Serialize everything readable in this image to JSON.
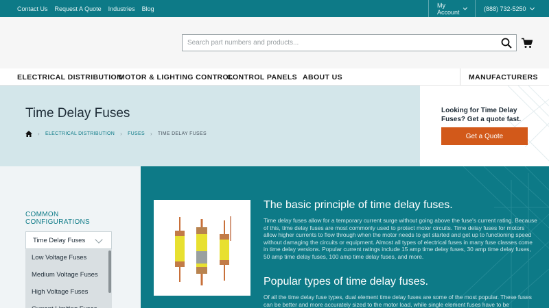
{
  "topbar": {
    "links": [
      "Contact Us",
      "Request A Quote",
      "Industries",
      "Blog"
    ],
    "account": "My Account",
    "phone": "(888) 732-5250"
  },
  "search": {
    "placeholder": "Search part numbers and products..."
  },
  "nav": {
    "items": [
      "ELECTRICAL DISTRIBUTION",
      "MOTOR & LIGHTING CONTROL",
      "CONTROL PANELS",
      "ABOUT US"
    ],
    "manufacturers": "MANUFACTURERS"
  },
  "hero": {
    "title": "Time Delay Fuses",
    "breadcrumbs": [
      "ELECTRICAL DISTRIBUTION",
      "FUSES",
      "TIME DELAY FUSES"
    ]
  },
  "quote": {
    "text": "Looking for Time Delay Fuses? Get a quote fast.",
    "button": "Get a Quote"
  },
  "sidebar": {
    "heading_line1": "COMMON",
    "heading_line2": "CONFIGURATIONS",
    "selected": "Time Delay Fuses",
    "options": [
      "Low Voltage Fuses",
      "Medium Voltage Fuses",
      "High Voltage Fuses",
      "Current Limiting Fuses"
    ]
  },
  "content": {
    "h1": "The basic principle of time delay fuses.",
    "p1": "Time delay fuses allow for a temporary current surge without going above the fuse's current rating. Because of this, time delay fuses are most commonly used to protect motor circuits. Time delay fuses for motors allow higher currents to flow through when the motor needs to get started and get up to functioning speed without damaging the circuits or equipment. Almost all types of electrical fuses in many fuse classes come in time delay versions. Popular current ratings include 15 amp time delay fuses, 30 amp time delay fuses, 50 amp time delay fuses, 100 amp time delay fuses, and more.",
    "h2": "Popular types of time delay fuses.",
    "p2": "Of all the time delay fuse types, dual element time delay fuses are some of the most popular. These fuses can be better and more accurately sized to the motor load, while single element fuses have to be"
  },
  "colors": {
    "teal": "#0d7a87",
    "accent": "#d2591a",
    "hero": "#d3e6ea"
  }
}
